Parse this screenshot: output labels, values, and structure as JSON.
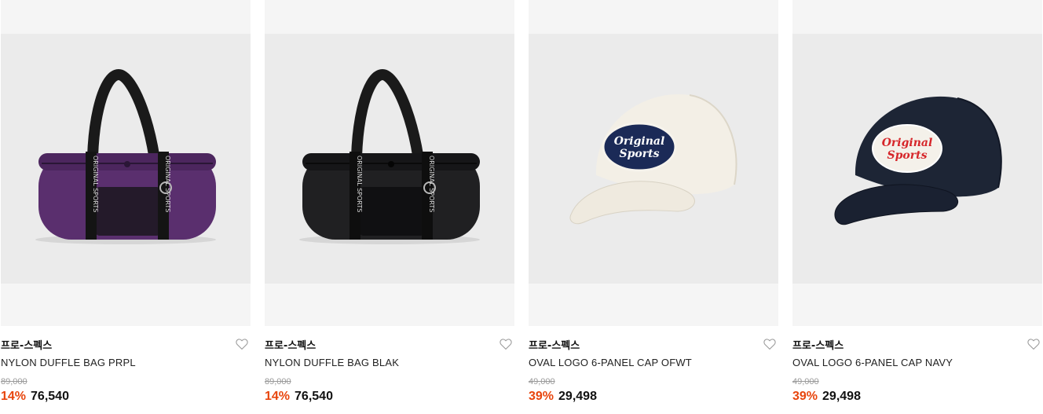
{
  "colors": {
    "discount": "#e8450d",
    "original_price": "#9a9a9a",
    "thumb_bg": "#ebebeb"
  },
  "products": [
    {
      "brand": "프로-스펙스",
      "name": "NYLON DUFFLE BAG PRPL",
      "original_price": "89,000",
      "discount": "14%",
      "price": "76,540",
      "image_icon": "purple-duffle-bag-image",
      "wish_icon": "heart-outline-icon",
      "strap_text": "ORIGINAL SPORTS"
    },
    {
      "brand": "프로-스펙스",
      "name": "NYLON DUFFLE BAG BLAK",
      "original_price": "89,000",
      "discount": "14%",
      "price": "76,540",
      "image_icon": "black-duffle-bag-image",
      "wish_icon": "heart-outline-icon",
      "strap_text": "ORIGINAL SPORTS"
    },
    {
      "brand": "프로-스펙스",
      "name": "OVAL LOGO 6-PANEL CAP OFWT",
      "original_price": "49,000",
      "discount": "39%",
      "price": "29,498",
      "image_icon": "off-white-cap-image",
      "wish_icon": "heart-outline-icon",
      "logo_line1": "Original",
      "logo_line2": "Sports"
    },
    {
      "brand": "프로-스펙스",
      "name": "OVAL LOGO 6-PANEL CAP NAVY",
      "original_price": "49,000",
      "discount": "39%",
      "price": "29,498",
      "image_icon": "navy-cap-image",
      "wish_icon": "heart-outline-icon",
      "logo_line1": "Original",
      "logo_line2": "Sports"
    }
  ]
}
